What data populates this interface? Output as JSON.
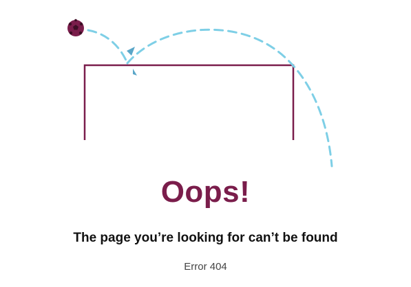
{
  "error_page": {
    "headline": "Oops!",
    "message": "The page you’re looking for can’t be found",
    "error_code": "Error 404"
  },
  "illustration": {
    "icons": [
      "soccer-ball-icon",
      "goal-icon",
      "trajectory-arrow-icon"
    ]
  },
  "colors": {
    "brand": "#7a1d4b",
    "trajectory": "#7ecfe6",
    "arrow": "#5aa6c8",
    "text": "#111111",
    "muted": "#444444"
  }
}
